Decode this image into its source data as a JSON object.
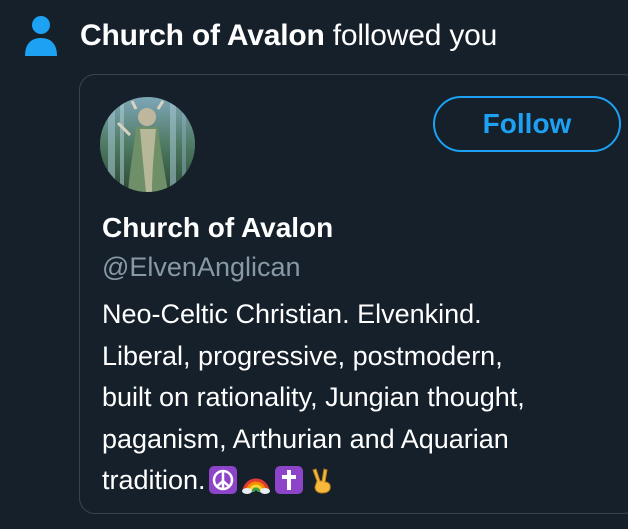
{
  "notification": {
    "actor_name": "Church of Avalon",
    "action_text": " followed you"
  },
  "profile_card": {
    "follow_label": "Follow",
    "display_name": "Church of Avalon",
    "handle": "@ElvenAnglican",
    "bio_lines": [
      "Neo-Celtic Christian. Elvenkind.",
      "Liberal, progressive, postmodern,",
      "built on rationality, Jungian thought,",
      "paganism, Arthurian and Aquarian",
      "tradition."
    ],
    "bio_emojis": [
      "peace-symbol-emoji",
      "rainbow-emoji",
      "latin-cross-emoji",
      "victory-hand-emoji"
    ]
  },
  "colors": {
    "background": "#15202b",
    "accent": "#1da1f2",
    "secondary_text": "#8899a6",
    "card_border": "#38444d"
  }
}
